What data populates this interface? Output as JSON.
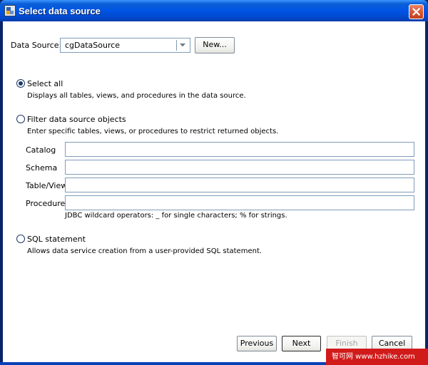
{
  "window": {
    "title": "Select data source"
  },
  "data_source": {
    "label": "Data Source:",
    "value": "cgDataSource",
    "new_button": "New..."
  },
  "options": {
    "select_all": {
      "label": "Select all",
      "description": "Displays all tables, views, and procedures in the data source.",
      "selected": true
    },
    "filter": {
      "label": "Filter data source objects",
      "description": "Enter specific tables, views, or procedures to restrict returned objects.",
      "selected": false
    },
    "sql": {
      "label": "SQL statement",
      "description": "Allows data service creation from a user-provided SQL statement.",
      "selected": false
    }
  },
  "filter_fields": {
    "catalog": {
      "label": "Catalog",
      "value": ""
    },
    "schema": {
      "label": "Schema",
      "value": ""
    },
    "table_view": {
      "label": "Table/View",
      "value": ""
    },
    "procedure": {
      "label": "Procedure",
      "value": ""
    },
    "hint": "JDBC wildcard operators: _ for single characters; % for strings."
  },
  "buttons": {
    "previous": "Previous",
    "next": "Next",
    "finish": "Finish",
    "cancel": "Cancel"
  },
  "watermark": {
    "text": "智可网 www.hzhike.com"
  },
  "colors": {
    "titlebar": "#0055e5",
    "close": "#d85b3a",
    "field_border": "#7f9db9"
  }
}
